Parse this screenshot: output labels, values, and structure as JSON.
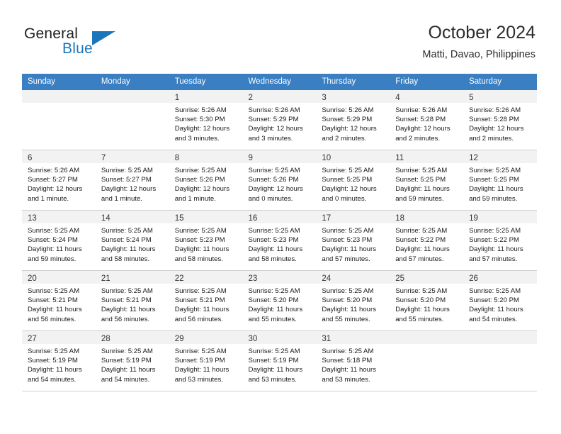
{
  "logo": {
    "word_top": "General",
    "word_bottom": "Blue",
    "triangle_color": "#1b75bb",
    "icon": "general-blue-logo"
  },
  "header": {
    "title": "October 2024",
    "subtitle": "Matti, Davao, Philippines"
  },
  "theme": {
    "header_row_bg": "#3a7fc1",
    "daynum_bg": "#f2f2f2",
    "grid_line": "#cfcfcf",
    "text": "#1a1a1a",
    "accent_blue": "#1b75bb"
  },
  "weekday_headers": [
    "Sunday",
    "Monday",
    "Tuesday",
    "Wednesday",
    "Thursday",
    "Friday",
    "Saturday"
  ],
  "labels": {
    "sunrise_prefix": "Sunrise:",
    "sunset_prefix": "Sunset:",
    "daylight_prefix": "Daylight:"
  },
  "weeks": [
    [
      {
        "day": "",
        "sunrise": "",
        "sunset": "",
        "daylight_line1": "",
        "daylight_line2": ""
      },
      {
        "day": "",
        "sunrise": "",
        "sunset": "",
        "daylight_line1": "",
        "daylight_line2": ""
      },
      {
        "day": "1",
        "sunrise": "Sunrise: 5:26 AM",
        "sunset": "Sunset: 5:30 PM",
        "daylight_line1": "Daylight: 12 hours",
        "daylight_line2": "and 3 minutes."
      },
      {
        "day": "2",
        "sunrise": "Sunrise: 5:26 AM",
        "sunset": "Sunset: 5:29 PM",
        "daylight_line1": "Daylight: 12 hours",
        "daylight_line2": "and 3 minutes."
      },
      {
        "day": "3",
        "sunrise": "Sunrise: 5:26 AM",
        "sunset": "Sunset: 5:29 PM",
        "daylight_line1": "Daylight: 12 hours",
        "daylight_line2": "and 2 minutes."
      },
      {
        "day": "4",
        "sunrise": "Sunrise: 5:26 AM",
        "sunset": "Sunset: 5:28 PM",
        "daylight_line1": "Daylight: 12 hours",
        "daylight_line2": "and 2 minutes."
      },
      {
        "day": "5",
        "sunrise": "Sunrise: 5:26 AM",
        "sunset": "Sunset: 5:28 PM",
        "daylight_line1": "Daylight: 12 hours",
        "daylight_line2": "and 2 minutes."
      }
    ],
    [
      {
        "day": "6",
        "sunrise": "Sunrise: 5:26 AM",
        "sunset": "Sunset: 5:27 PM",
        "daylight_line1": "Daylight: 12 hours",
        "daylight_line2": "and 1 minute."
      },
      {
        "day": "7",
        "sunrise": "Sunrise: 5:25 AM",
        "sunset": "Sunset: 5:27 PM",
        "daylight_line1": "Daylight: 12 hours",
        "daylight_line2": "and 1 minute."
      },
      {
        "day": "8",
        "sunrise": "Sunrise: 5:25 AM",
        "sunset": "Sunset: 5:26 PM",
        "daylight_line1": "Daylight: 12 hours",
        "daylight_line2": "and 1 minute."
      },
      {
        "day": "9",
        "sunrise": "Sunrise: 5:25 AM",
        "sunset": "Sunset: 5:26 PM",
        "daylight_line1": "Daylight: 12 hours",
        "daylight_line2": "and 0 minutes."
      },
      {
        "day": "10",
        "sunrise": "Sunrise: 5:25 AM",
        "sunset": "Sunset: 5:25 PM",
        "daylight_line1": "Daylight: 12 hours",
        "daylight_line2": "and 0 minutes."
      },
      {
        "day": "11",
        "sunrise": "Sunrise: 5:25 AM",
        "sunset": "Sunset: 5:25 PM",
        "daylight_line1": "Daylight: 11 hours",
        "daylight_line2": "and 59 minutes."
      },
      {
        "day": "12",
        "sunrise": "Sunrise: 5:25 AM",
        "sunset": "Sunset: 5:25 PM",
        "daylight_line1": "Daylight: 11 hours",
        "daylight_line2": "and 59 minutes."
      }
    ],
    [
      {
        "day": "13",
        "sunrise": "Sunrise: 5:25 AM",
        "sunset": "Sunset: 5:24 PM",
        "daylight_line1": "Daylight: 11 hours",
        "daylight_line2": "and 59 minutes."
      },
      {
        "day": "14",
        "sunrise": "Sunrise: 5:25 AM",
        "sunset": "Sunset: 5:24 PM",
        "daylight_line1": "Daylight: 11 hours",
        "daylight_line2": "and 58 minutes."
      },
      {
        "day": "15",
        "sunrise": "Sunrise: 5:25 AM",
        "sunset": "Sunset: 5:23 PM",
        "daylight_line1": "Daylight: 11 hours",
        "daylight_line2": "and 58 minutes."
      },
      {
        "day": "16",
        "sunrise": "Sunrise: 5:25 AM",
        "sunset": "Sunset: 5:23 PM",
        "daylight_line1": "Daylight: 11 hours",
        "daylight_line2": "and 58 minutes."
      },
      {
        "day": "17",
        "sunrise": "Sunrise: 5:25 AM",
        "sunset": "Sunset: 5:23 PM",
        "daylight_line1": "Daylight: 11 hours",
        "daylight_line2": "and 57 minutes."
      },
      {
        "day": "18",
        "sunrise": "Sunrise: 5:25 AM",
        "sunset": "Sunset: 5:22 PM",
        "daylight_line1": "Daylight: 11 hours",
        "daylight_line2": "and 57 minutes."
      },
      {
        "day": "19",
        "sunrise": "Sunrise: 5:25 AM",
        "sunset": "Sunset: 5:22 PM",
        "daylight_line1": "Daylight: 11 hours",
        "daylight_line2": "and 57 minutes."
      }
    ],
    [
      {
        "day": "20",
        "sunrise": "Sunrise: 5:25 AM",
        "sunset": "Sunset: 5:21 PM",
        "daylight_line1": "Daylight: 11 hours",
        "daylight_line2": "and 56 minutes."
      },
      {
        "day": "21",
        "sunrise": "Sunrise: 5:25 AM",
        "sunset": "Sunset: 5:21 PM",
        "daylight_line1": "Daylight: 11 hours",
        "daylight_line2": "and 56 minutes."
      },
      {
        "day": "22",
        "sunrise": "Sunrise: 5:25 AM",
        "sunset": "Sunset: 5:21 PM",
        "daylight_line1": "Daylight: 11 hours",
        "daylight_line2": "and 56 minutes."
      },
      {
        "day": "23",
        "sunrise": "Sunrise: 5:25 AM",
        "sunset": "Sunset: 5:20 PM",
        "daylight_line1": "Daylight: 11 hours",
        "daylight_line2": "and 55 minutes."
      },
      {
        "day": "24",
        "sunrise": "Sunrise: 5:25 AM",
        "sunset": "Sunset: 5:20 PM",
        "daylight_line1": "Daylight: 11 hours",
        "daylight_line2": "and 55 minutes."
      },
      {
        "day": "25",
        "sunrise": "Sunrise: 5:25 AM",
        "sunset": "Sunset: 5:20 PM",
        "daylight_line1": "Daylight: 11 hours",
        "daylight_line2": "and 55 minutes."
      },
      {
        "day": "26",
        "sunrise": "Sunrise: 5:25 AM",
        "sunset": "Sunset: 5:20 PM",
        "daylight_line1": "Daylight: 11 hours",
        "daylight_line2": "and 54 minutes."
      }
    ],
    [
      {
        "day": "27",
        "sunrise": "Sunrise: 5:25 AM",
        "sunset": "Sunset: 5:19 PM",
        "daylight_line1": "Daylight: 11 hours",
        "daylight_line2": "and 54 minutes."
      },
      {
        "day": "28",
        "sunrise": "Sunrise: 5:25 AM",
        "sunset": "Sunset: 5:19 PM",
        "daylight_line1": "Daylight: 11 hours",
        "daylight_line2": "and 54 minutes."
      },
      {
        "day": "29",
        "sunrise": "Sunrise: 5:25 AM",
        "sunset": "Sunset: 5:19 PM",
        "daylight_line1": "Daylight: 11 hours",
        "daylight_line2": "and 53 minutes."
      },
      {
        "day": "30",
        "sunrise": "Sunrise: 5:25 AM",
        "sunset": "Sunset: 5:19 PM",
        "daylight_line1": "Daylight: 11 hours",
        "daylight_line2": "and 53 minutes."
      },
      {
        "day": "31",
        "sunrise": "Sunrise: 5:25 AM",
        "sunset": "Sunset: 5:18 PM",
        "daylight_line1": "Daylight: 11 hours",
        "daylight_line2": "and 53 minutes."
      },
      {
        "day": "",
        "sunrise": "",
        "sunset": "",
        "daylight_line1": "",
        "daylight_line2": ""
      },
      {
        "day": "",
        "sunrise": "",
        "sunset": "",
        "daylight_line1": "",
        "daylight_line2": ""
      }
    ]
  ]
}
